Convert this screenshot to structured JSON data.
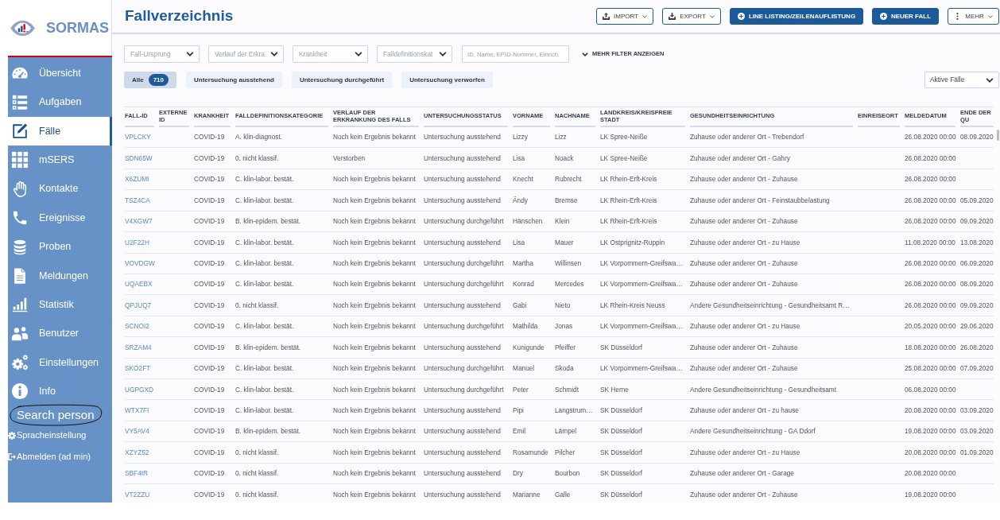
{
  "sidebar": {
    "logo": "SORMAS",
    "items": [
      {
        "label": "Übersicht",
        "selected": false
      },
      {
        "label": "Aufgaben",
        "selected": false
      },
      {
        "label": "Fälle",
        "selected": true
      },
      {
        "label": "mSERS",
        "selected": false
      },
      {
        "label": "Kontakte",
        "selected": false
      },
      {
        "label": "Ereignisse",
        "selected": false
      },
      {
        "label": "Proben",
        "selected": false
      },
      {
        "label": "Meldungen",
        "selected": false
      },
      {
        "label": "Statistik",
        "selected": false
      },
      {
        "label": "Benutzer",
        "selected": false
      },
      {
        "label": "Einstellungen",
        "selected": false
      },
      {
        "label": "Info",
        "selected": false
      }
    ],
    "search_person": "Search person",
    "language": "Spracheinstellung",
    "logout": "Abmelden (ad min)"
  },
  "header": {
    "title": "Fallverzeichnis",
    "buttons": [
      {
        "label": "IMPORT",
        "kind": "dropdown"
      },
      {
        "label": "EXPORT",
        "kind": "dropdown"
      },
      {
        "label": "LINE LISTING/ZEILENAUFLISTUNG",
        "kind": "primary"
      },
      {
        "label": "NEUER FALL",
        "kind": "primary"
      },
      {
        "label": "MEHR",
        "kind": "dropdown"
      }
    ]
  },
  "filters": {
    "selects": [
      {
        "placeholder": "Fall-Ursprung"
      },
      {
        "placeholder": "Verlauf der Erkra"
      },
      {
        "placeholder": "Krankheit"
      },
      {
        "placeholder": "Falldefinitionskat"
      }
    ],
    "search": {
      "placeholder": "ID, Name, EPID-Nummer, Einrich"
    },
    "more_filters": "MEHR FILTER ANZEIGEN"
  },
  "status_tabs": [
    {
      "label": "Alle",
      "count": "710",
      "selected": true
    },
    {
      "label": "Untersuchung ausstehend",
      "selected": false
    },
    {
      "label": "Untersuchung durchgeführt",
      "selected": false
    },
    {
      "label": "Untersuchung verworfen",
      "selected": false
    }
  ],
  "relevance_select": {
    "value": "Aktive Fälle"
  },
  "table": {
    "columns": [
      "FALL-ID",
      "EXTERNE ID",
      "KRANKHEIT",
      "FALLDEFINITIONSKATEGORIE",
      "VERLAUF DER ERKRANKUNG DES FALLS",
      "UNTERSUCHUNGSSTATUS",
      "VORNAME",
      "NACHNAME",
      "LANDKREIS/KREISFREIE STADT",
      "GESUNDHEITSEINRICHTUNG",
      "EINREISEORT",
      "MELDEDATUM",
      "ENDE DER QU"
    ],
    "rows": [
      {
        "fall_id": "VPLCKY",
        "krankheit": "COVID-19",
        "falldefinitionskategorie": "A. klin-diagnost.",
        "verlauf": "Noch kein Ergebnis bekannt",
        "untersuchungsstatus": "Untersuchung ausstehend",
        "vorname": "Lizzy",
        "nachname": "Lizz",
        "landkreis": "LK Spree-Neiße",
        "gesundheitseinrichtung": "Zuhause oder anderer Ort - Trebendorf",
        "meldedatum": "26.08.2020 00:00",
        "ende_der_qu": "08.09.2020"
      },
      {
        "fall_id": "SDN65W",
        "krankheit": "COVID-19",
        "falldefinitionskategorie": "0. nicht klassif.",
        "verlauf": "Verstorben",
        "untersuchungsstatus": "Untersuchung ausstehend",
        "vorname": "Lisa",
        "nachname": "Noack",
        "landkreis": "LK Spree-Neiße",
        "gesundheitseinrichtung": "Zuhause oder anderer Ort - Gahry",
        "meldedatum": "26.08.2020 00:00"
      },
      {
        "fall_id": "X6ZUMI",
        "krankheit": "COVID-19",
        "falldefinitionskategorie": "C. klin-labor. bestät.",
        "verlauf": "Noch kein Ergebnis bekannt",
        "untersuchungsstatus": "Untersuchung ausstehend",
        "vorname": "Knecht",
        "nachname": "Rubrecht",
        "landkreis": "LK Rhein-Erft-Kreis",
        "gesundheitseinrichtung": "Zuhause oder anderer Ort - Zuhause",
        "meldedatum": "26.08.2020 00:00"
      },
      {
        "fall_id": "TSZ4CA",
        "krankheit": "COVID-19",
        "falldefinitionskategorie": "C. klin-labor. bestät.",
        "verlauf": "Noch kein Ergebnis bekannt",
        "untersuchungsstatus": "Untersuchung ausstehend",
        "vorname": "Ändy",
        "nachname": "Bremse",
        "landkreis": "LK Rhein-Erft-Kreis",
        "gesundheitseinrichtung": "Zuhause oder anderer Ort - Feinstaubbelastung",
        "meldedatum": "26.08.2020 00:00",
        "ende_der_qu": "05.09.2020"
      },
      {
        "fall_id": "V4XGW7",
        "krankheit": "COVID-19",
        "falldefinitionskategorie": "B. klin-epidem. bestät.",
        "verlauf": "Noch kein Ergebnis bekannt",
        "untersuchungsstatus": "Untersuchung durchgeführt",
        "vorname": "Hänschen",
        "nachname": "Klein",
        "landkreis": "LK Rhein-Erft-Kreis",
        "gesundheitseinrichtung": "Zuhause oder anderer Ort - Zuhause",
        "meldedatum": "26.08.2020 00:00",
        "ende_der_qu": "09.09.2020"
      },
      {
        "fall_id": "U2F22H",
        "krankheit": "COVID-19",
        "falldefinitionskategorie": "C. klin-labor. bestät.",
        "verlauf": "Noch kein Ergebnis bekannt",
        "untersuchungsstatus": "Untersuchung ausstehend",
        "vorname": "Lisa",
        "nachname": "Mauer",
        "landkreis": "LK Ostprignitz-Ruppin",
        "gesundheitseinrichtung": "Zuhause oder anderer Ort - zu Hause",
        "meldedatum": "11.08.2020 00:00",
        "ende_der_qu": "13.08.2020"
      },
      {
        "fall_id": "VOVDGW",
        "krankheit": "COVID-19",
        "falldefinitionskategorie": "C. klin-labor. bestät.",
        "verlauf": "Noch kein Ergebnis bekannt",
        "untersuchungsstatus": "Untersuchung durchgeführt",
        "vorname": "Martha",
        "nachname": "Willinsen",
        "landkreis": "LK Vorpommern-Greifswa…",
        "gesundheitseinrichtung": "Zuhause oder anderer Ort - Zuhause",
        "meldedatum": "26.08.2020 00:00",
        "ende_der_qu": "06.09.2020"
      },
      {
        "fall_id": "UQAEBX",
        "krankheit": "COVID-19",
        "falldefinitionskategorie": "C. klin-labor. bestät.",
        "verlauf": "Noch kein Ergebnis bekannt",
        "untersuchungsstatus": "Untersuchung durchgeführt",
        "vorname": "Konrad",
        "nachname": "Mercedes",
        "landkreis": "LK Vorpommern-Greifswa…",
        "gesundheitseinrichtung": "Zuhause oder anderer Ort - Zuhause",
        "meldedatum": "26.08.2020 00:00",
        "ende_der_qu": "08.09.2020"
      },
      {
        "fall_id": "QPJUQ7",
        "krankheit": "COVID-19",
        "falldefinitionskategorie": "0. nicht klassif.",
        "verlauf": "Noch kein Ergebnis bekannt",
        "untersuchungsstatus": "Untersuchung ausstehend",
        "vorname": "Gabi",
        "nachname": "Nieto",
        "landkreis": "LK Rhein-Kreis Neuss",
        "gesundheitseinrichtung": "Andere Gesundheitseinrichtung - Gesundheitsamt R…",
        "meldedatum": "26.08.2020 00:00",
        "ende_der_qu": "09.09.2020"
      },
      {
        "fall_id": "SCNOI2",
        "krankheit": "COVID-19",
        "falldefinitionskategorie": "C. klin-labor. bestät.",
        "verlauf": "Noch kein Ergebnis bekannt",
        "untersuchungsstatus": "Untersuchung durchgeführt",
        "vorname": "Mathilda",
        "nachname": "Jonas",
        "landkreis": "LK Vorpommern-Greifswa…",
        "gesundheitseinrichtung": "Zuhause oder anderer Ort - zu Hause",
        "meldedatum": "20.05.2020 00:00",
        "ende_der_qu": "29.06.2020"
      },
      {
        "fall_id": "SRZAM4",
        "krankheit": "COVID-19",
        "falldefinitionskategorie": "B. klin-epidem. bestät.",
        "verlauf": "Noch kein Ergebnis bekannt",
        "untersuchungsstatus": "Untersuchung ausstehend",
        "vorname": "Kunigunde",
        "nachname": "Pfeiffer",
        "landkreis": "SK Düsseldorf",
        "gesundheitseinrichtung": "Zuhause oder anderer Ort - Zuhause",
        "meldedatum": "18.08.2020 00:00",
        "ende_der_qu": "26.08.2020"
      },
      {
        "fall_id": "SKO2FT",
        "krankheit": "COVID-19",
        "falldefinitionskategorie": "C. klin-labor. bestät.",
        "verlauf": "Noch kein Ergebnis bekannt",
        "untersuchungsstatus": "Untersuchung durchgeführt",
        "vorname": "Manuel",
        "nachname": "Skoda",
        "landkreis": "LK Vorpommern-Greifswa…",
        "gesundheitseinrichtung": "Zuhause oder anderer Ort - Zuhause",
        "meldedatum": "25.08.2020 00:00",
        "ende_der_qu": "07.09.2020"
      },
      {
        "fall_id": "UGPGXD",
        "krankheit": "COVID-19",
        "falldefinitionskategorie": "C. klin-labor. bestät.",
        "verlauf": "Noch kein Ergebnis bekannt",
        "untersuchungsstatus": "Untersuchung durchgeführt",
        "vorname": "Peter",
        "nachname": "Schmidt",
        "landkreis": "SK Herne",
        "gesundheitseinrichtung": "Andere Gesundheitseinrichtung - Gesundheitsamt",
        "meldedatum": "06.08.2020 00:00"
      },
      {
        "fall_id": "WTX7FI",
        "krankheit": "COVID-19",
        "falldefinitionskategorie": "C. klin-labor. bestät.",
        "verlauf": "Noch kein Ergebnis bekannt",
        "untersuchungsstatus": "Untersuchung ausstehend",
        "vorname": "Pipi",
        "nachname": "Langstrum…",
        "landkreis": "SK Düsseldorf",
        "gesundheitseinrichtung": "Zuhause oder anderer Ort - zu hause",
        "meldedatum": "20.08.2020 00:00",
        "ende_der_qu": "03.09.2020"
      },
      {
        "fall_id": "VY5AV4",
        "krankheit": "COVID-19",
        "falldefinitionskategorie": "B. klin-epidem. bestät.",
        "verlauf": "Noch kein Ergebnis bekannt",
        "untersuchungsstatus": "Untersuchung ausstehend",
        "vorname": "Emil",
        "nachname": "Lämpel",
        "landkreis": "SK Düsseldorf",
        "gesundheitseinrichtung": "Andere Gesundheitseinrichtung - GA Ddorf",
        "meldedatum": "19.08.2020 00:00",
        "ende_der_qu": "03.09.2020"
      },
      {
        "fall_id": "XZYZ52",
        "krankheit": "COVID-19",
        "falldefinitionskategorie": "0. nicht klassif.",
        "verlauf": "Noch kein Ergebnis bekannt",
        "untersuchungsstatus": "Untersuchung ausstehend",
        "vorname": "Rosamunde",
        "nachname": "Pilcher",
        "landkreis": "SK Düsseldorf",
        "gesundheitseinrichtung": "Zuhause oder anderer Ort - zu Hause",
        "meldedatum": "20.08.2020 00:00",
        "ende_der_qu": "01.09.2020"
      },
      {
        "fall_id": "SBF4IR",
        "krankheit": "COVID-19",
        "falldefinitionskategorie": "0. nicht klassif.",
        "verlauf": "Noch kein Ergebnis bekannt",
        "untersuchungsstatus": "Untersuchung ausstehend",
        "vorname": "Dry",
        "nachname": "Bourbon",
        "landkreis": "SK Düsseldorf",
        "gesundheitseinrichtung": "Zuhause oder anderer Ort - Garage",
        "meldedatum": "20.08.2020 00:00"
      },
      {
        "fall_id": "VT2ZZU",
        "krankheit": "COVID-19",
        "falldefinitionskategorie": "0. nicht klassif.",
        "verlauf": "Noch kein Ergebnis bekannt",
        "untersuchungsstatus": "Untersuchung ausstehend",
        "vorname": "Marianne",
        "nachname": "Galle",
        "landkreis": "SK Düsseldorf",
        "gesundheitseinrichtung": "Zuhause oder anderer Ort - Zuhause",
        "meldedatum": "19.08.2020 00:00"
      }
    ]
  }
}
